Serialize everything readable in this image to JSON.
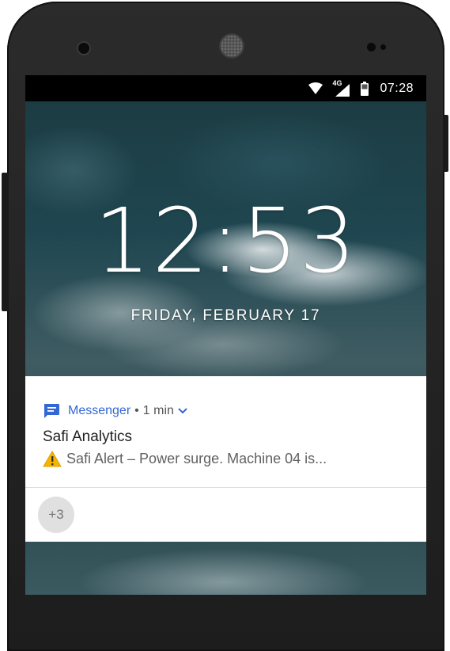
{
  "status_bar": {
    "network": "4G",
    "time": "07:28",
    "icons": [
      "wifi-icon",
      "cell-signal-icon",
      "battery-icon"
    ]
  },
  "lock_screen": {
    "clock": "12:53",
    "date": "FRIDAY, FEBRUARY 17"
  },
  "notification": {
    "app_icon": "messenger-icon",
    "app_name": "Messenger",
    "separator": "•",
    "time_ago": "1 min",
    "title": "Safi Analytics",
    "body_icon": "warning-icon",
    "body": "Safi Alert – Power surge. Machine 04 is..."
  },
  "more_notifications": {
    "count_label": "+3"
  },
  "colors": {
    "accent": "#3367d6",
    "warning": "#f4b400",
    "status_bar": "#000000"
  }
}
